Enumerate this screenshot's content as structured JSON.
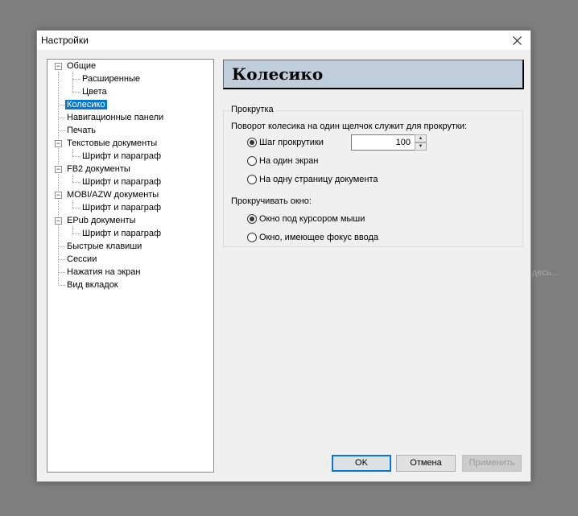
{
  "background_hint": "здесь...",
  "window": {
    "title": "Настройки",
    "close_icon": "close-icon"
  },
  "tree": {
    "items": [
      {
        "label": "Общие",
        "expander": "−"
      },
      {
        "label": "Расширенные"
      },
      {
        "label": "Цвета"
      },
      {
        "label": "Колесико",
        "selected": true
      },
      {
        "label": "Навигационные панели"
      },
      {
        "label": "Печать"
      },
      {
        "label": "Текстовые документы",
        "expander": "−"
      },
      {
        "label": "Шрифт и параграф"
      },
      {
        "label": "FB2 документы",
        "expander": "−"
      },
      {
        "label": "Шрифт и параграф"
      },
      {
        "label": "MOBI/AZW документы",
        "expander": "−"
      },
      {
        "label": "Шрифт и параграф"
      },
      {
        "label": "EPub документы",
        "expander": "−"
      },
      {
        "label": "Шрифт и параграф"
      },
      {
        "label": "Быстрые клавиши"
      },
      {
        "label": "Сессии"
      },
      {
        "label": "Нажатия на экран"
      },
      {
        "label": "Вид вкладок"
      }
    ]
  },
  "panel": {
    "header": "Колесико",
    "group_title": "Прокрутка",
    "scroll_question": "Поворот колесика на один щелчок служит для прокрутки:",
    "scroll_options": [
      {
        "label": "Шаг прокрутики",
        "checked": true
      },
      {
        "label": "На один экран",
        "checked": false
      },
      {
        "label": "На одну страницу документа",
        "checked": false
      }
    ],
    "step_value": "100",
    "window_question": "Прокручивать окно:",
    "window_options": [
      {
        "label": "Окно под курсором мыши",
        "checked": true
      },
      {
        "label": "Окно, имеющее фокус ввода",
        "checked": false
      }
    ]
  },
  "buttons": {
    "ok": "OK",
    "cancel": "Отмена",
    "apply": "Применить"
  },
  "colors": {
    "selection": "#0078d7",
    "header_bg": "#c0cedc",
    "dialog_bg": "#f0f0f0"
  }
}
